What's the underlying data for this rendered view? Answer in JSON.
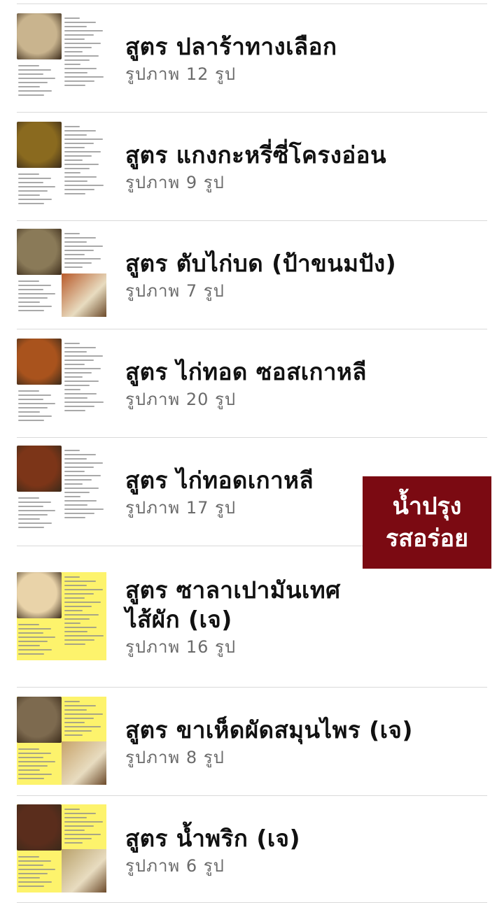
{
  "albums": [
    {
      "title": "สูตร ปลาร้าทางเลือก",
      "count": "รูปภาพ 12 รูป",
      "thumb": "plain",
      "photo_color": "#c9b48e",
      "photo2_color": ""
    },
    {
      "title": "สูตร แกงกะหรี่ซี่โครงอ่อน",
      "count": "รูปภาพ 9 รูป",
      "thumb": "plain",
      "photo_color": "#8a6a1f",
      "photo2_color": ""
    },
    {
      "title": "สูตร ตับไก่บด (ป้าขนมปัง)",
      "count": "รูปภาพ 7 รูป",
      "thumb": "plain",
      "photo_color": "#8a7a58",
      "photo2_color": "#b85a2a"
    },
    {
      "title": "สูตร ไก่ทอด ซอสเกาหลี",
      "count": "รูปภาพ 20 รูป",
      "thumb": "plain",
      "photo_color": "#a9531d",
      "photo2_color": ""
    },
    {
      "title": "สูตร ไก่ทอดเกาหลี",
      "count": "รูปภาพ 17 รูป",
      "thumb": "plain",
      "photo_color": "#7c3518",
      "photo2_color": ""
    },
    {
      "title": "สูตร ซาลาเปามันเทศ",
      "title_line2": "ไส้ผัก (เจ)",
      "count": "รูปภาพ 16 รูป",
      "thumb": "yellow",
      "photo_color": "#e9d3a9",
      "photo2_color": ""
    },
    {
      "title": "สูตร ขาเห็ดผัดสมุนไพร (เจ)",
      "count": "รูปภาพ 8 รูป",
      "thumb": "yellow",
      "photo_color": "#7d6a4f",
      "photo2_color": "#c7a36a"
    },
    {
      "title": "สูตร น้ำพริก (เจ)",
      "count": "รูปภาพ 6 รูป",
      "thumb": "yellow",
      "photo_color": "#5a2d1c",
      "photo2_color": "#b9a26b"
    }
  ],
  "badge": {
    "line1": "น้ำปรุง",
    "line2": "รสอร่อย",
    "color": "#7b0a12"
  },
  "colors": {
    "divider": "#d9d9d9",
    "title": "#111111",
    "count": "#6b6b6b",
    "yellow_thumb": "#fdf36c"
  }
}
